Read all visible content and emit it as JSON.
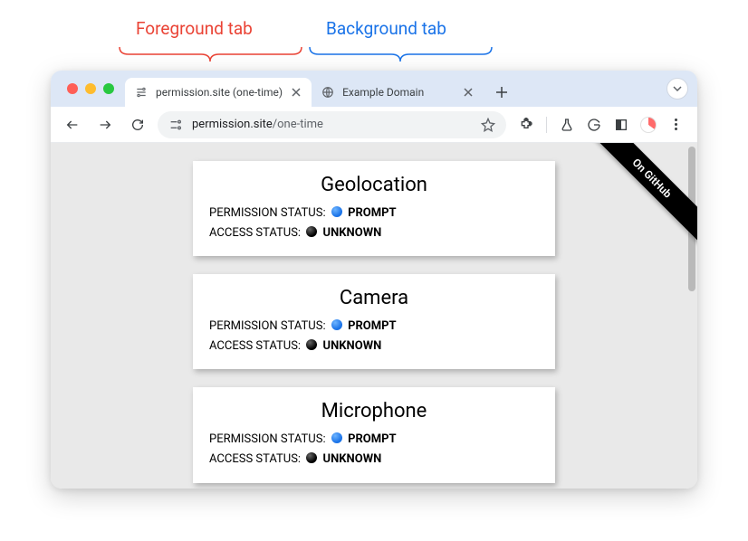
{
  "annotations": {
    "foreground": "Foreground tab",
    "background": "Background tab"
  },
  "tabs": [
    {
      "title": "permission.site (one-time)",
      "active": true
    },
    {
      "title": "Example Domain",
      "active": false
    }
  ],
  "omnibox": {
    "host": "permission.site",
    "path": "/one-time"
  },
  "ribbon": "On GitHub",
  "cards": [
    {
      "title": "Geolocation",
      "perm_label": "PERMISSION STATUS:",
      "perm_value": "PROMPT",
      "perm_color": "blue",
      "access_label": "ACCESS STATUS:",
      "access_value": "UNKNOWN",
      "access_color": "black"
    },
    {
      "title": "Camera",
      "perm_label": "PERMISSION STATUS:",
      "perm_value": "PROMPT",
      "perm_color": "blue",
      "access_label": "ACCESS STATUS:",
      "access_value": "UNKNOWN",
      "access_color": "black"
    },
    {
      "title": "Microphone",
      "perm_label": "PERMISSION STATUS:",
      "perm_value": "PROMPT",
      "perm_color": "blue",
      "access_label": "ACCESS STATUS:",
      "access_value": "UNKNOWN",
      "access_color": "black"
    }
  ]
}
